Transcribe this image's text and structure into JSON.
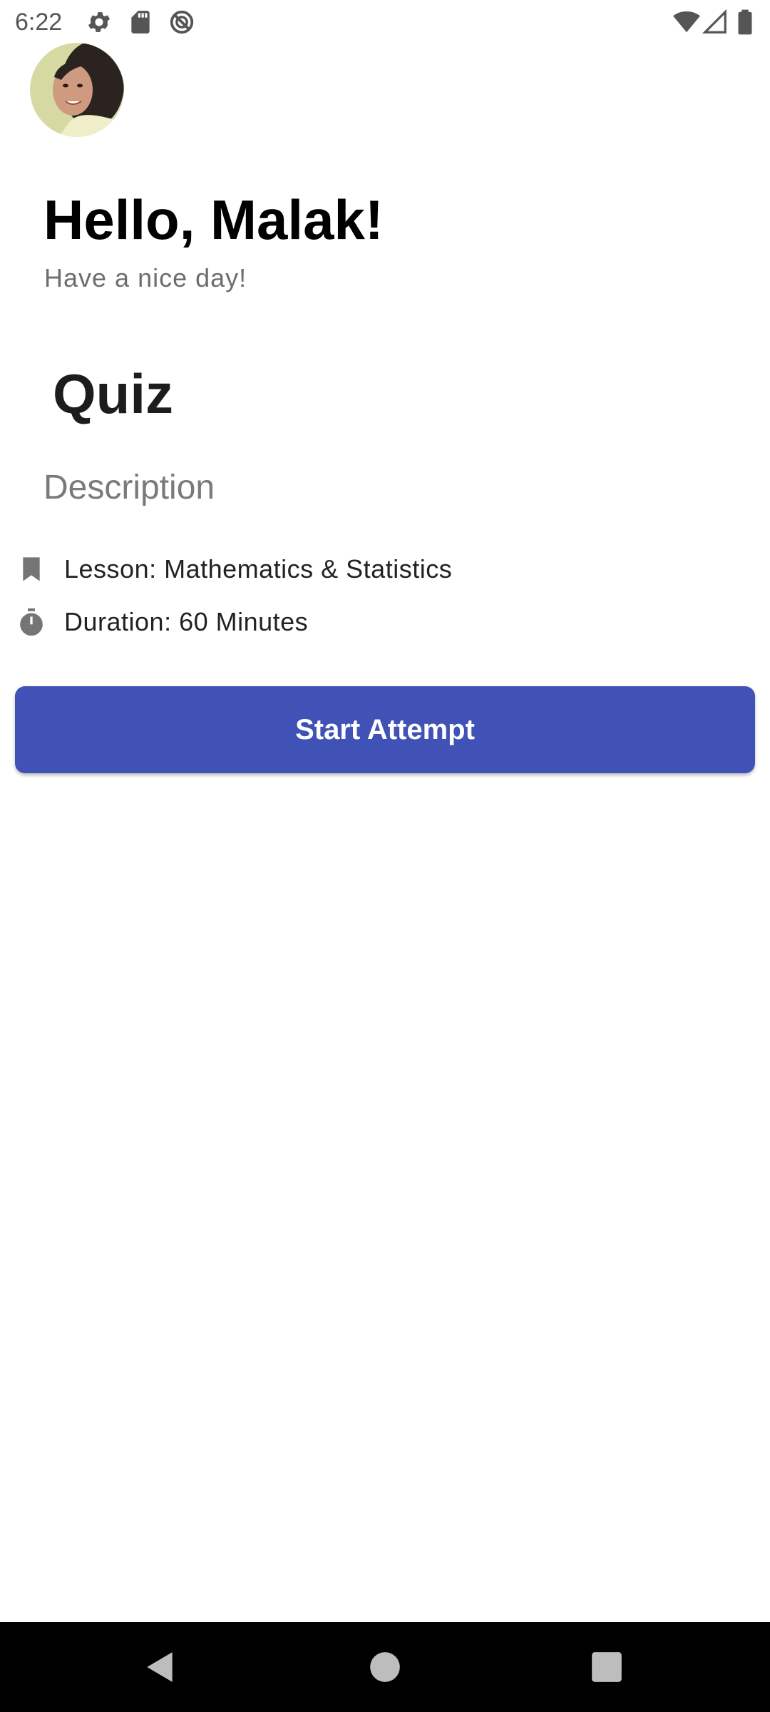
{
  "status_bar": {
    "time": "6:22",
    "icons": [
      "gear-icon",
      "sd-card-icon",
      "no-disturb-icon",
      "wifi-icon",
      "signal-icon",
      "battery-icon"
    ]
  },
  "header": {
    "avatar": "avatar",
    "greeting": "Hello, Malak!",
    "subgreeting": "Have a nice day!"
  },
  "quiz": {
    "title": "Quiz",
    "description": "Description",
    "lesson": "Lesson: Mathematics & Statistics",
    "duration": "Duration: 60 Minutes",
    "start_label": "Start Attempt"
  },
  "colors": {
    "accent": "#4052b5",
    "icon_gray": "#757575",
    "nav_bar": "#000000"
  },
  "nav_bar": {
    "buttons": [
      "back-icon",
      "home-icon",
      "recents-icon"
    ]
  }
}
